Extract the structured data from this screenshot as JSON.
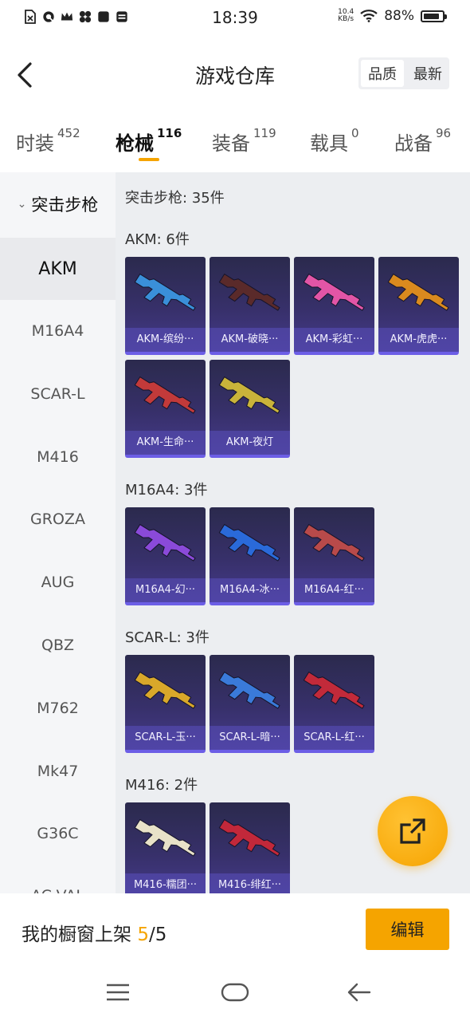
{
  "status_bar": {
    "time": "18:39",
    "net_speed_top": "10.4",
    "net_speed_unit": "KB/s",
    "battery": "88%",
    "icons": [
      "sim-icon",
      "q-app-icon",
      "crown-icon",
      "pinwheel-icon",
      "app-square-icon",
      "app-list-icon"
    ]
  },
  "header": {
    "title": "游戏仓库",
    "sort_options": [
      "品质",
      "最新"
    ],
    "sort_active": "品质"
  },
  "tabs": [
    {
      "label": "时装",
      "count": "452"
    },
    {
      "label": "枪械",
      "count": "116",
      "active": true
    },
    {
      "label": "装备",
      "count": "119"
    },
    {
      "label": "载具",
      "count": "0"
    },
    {
      "label": "战备",
      "count": "96"
    }
  ],
  "sidebar": {
    "group": "突击步枪",
    "items": [
      "AKM",
      "M16A4",
      "SCAR-L",
      "M416",
      "GROZA",
      "AUG",
      "QBZ",
      "M762",
      "Mk47",
      "G36C",
      "AC-VAL"
    ],
    "active": "AKM"
  },
  "main": {
    "summary": "突击步枪: 35件",
    "sections": [
      {
        "title": "AKM: 6件",
        "items": [
          {
            "name": "AKM-缤纷···",
            "color": "#3a8fd9"
          },
          {
            "name": "AKM-破晓···",
            "color": "#5a2a2a"
          },
          {
            "name": "AKM-彩虹···",
            "color": "#e255a6"
          },
          {
            "name": "AKM-虎虎···",
            "color": "#d98a1e"
          },
          {
            "name": "AKM-生命···",
            "color": "#c23a3a"
          },
          {
            "name": "AKM-夜灯",
            "color": "#c9b33a"
          }
        ]
      },
      {
        "title": "M16A4: 3件",
        "items": [
          {
            "name": "M16A4-幻···",
            "color": "#8a4ad9"
          },
          {
            "name": "M16A4-冰···",
            "color": "#2a6ad9"
          },
          {
            "name": "M16A4-红···",
            "color": "#b84a4a"
          }
        ]
      },
      {
        "title": "SCAR-L: 3件",
        "items": [
          {
            "name": "SCAR-L-玉···",
            "color": "#d9a82a"
          },
          {
            "name": "SCAR-L-暗···",
            "color": "#3a7ad9"
          },
          {
            "name": "SCAR-L-红···",
            "color": "#c22a3a"
          }
        ]
      },
      {
        "title": "M416: 2件",
        "items": [
          {
            "name": "M416-糯团···",
            "color": "#e8e2c8"
          },
          {
            "name": "M416-绯红···",
            "color": "#c2283a"
          }
        ]
      }
    ]
  },
  "showcase": {
    "label": "我的橱窗上架",
    "current": "5",
    "total": "/5",
    "edit_label": "编辑"
  },
  "colors": {
    "accent": "#f5a400",
    "card_bg": "#37306a",
    "card_border": "#6c5ee6"
  }
}
